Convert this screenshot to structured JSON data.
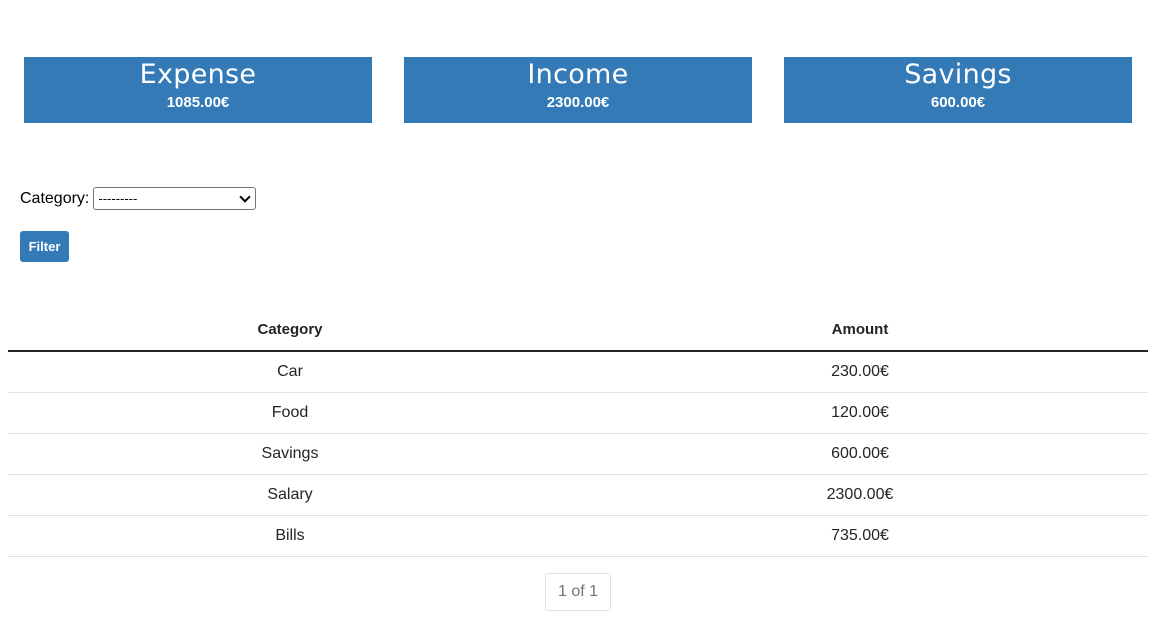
{
  "summary": [
    {
      "title": "Expense",
      "value": "1085.00€"
    },
    {
      "title": "Income",
      "value": "2300.00€"
    },
    {
      "title": "Savings",
      "value": "600.00€"
    }
  ],
  "filter": {
    "category_label": "Category:",
    "category_selected": "---------",
    "button_label": "Filter"
  },
  "table": {
    "headers": [
      "Category",
      "Amount"
    ],
    "rows": [
      [
        "Car",
        "230.00€"
      ],
      [
        "Food",
        "120.00€"
      ],
      [
        "Savings",
        "600.00€"
      ],
      [
        "Salary",
        "2300.00€"
      ],
      [
        "Bills",
        "735.00€"
      ]
    ]
  },
  "pagination": {
    "label": "1 of 1"
  },
  "colors": {
    "accent": "#337ab7"
  }
}
